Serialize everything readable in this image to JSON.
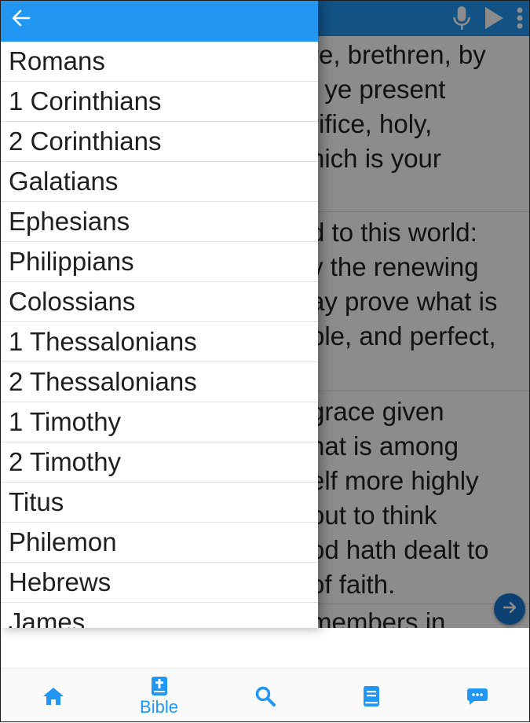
{
  "verses": [
    [
      "re, brethren, by",
      "t ye present",
      "rifice, holy,",
      "hich is your"
    ],
    [
      "d to this world:",
      "y the renewing",
      "ay prove what is",
      "ble, and perfect,"
    ],
    [
      "grace given",
      "hat is among",
      "elf more highly",
      "out to think",
      "od hath dealt to",
      "of faith."
    ],
    [
      "members in"
    ]
  ],
  "drawer": {
    "books": [
      "Romans",
      "1 Corinthians",
      "2 Corinthians",
      "Galatians",
      "Ephesians",
      "Philippians",
      "Colossians",
      "1 Thessalonians",
      "2 Thessalonians",
      "1 Timothy",
      "2 Timothy",
      "Titus",
      "Philemon",
      "Hebrews",
      "James"
    ]
  },
  "bottom_nav": {
    "bible_label": "Bible"
  },
  "icons": {
    "back": "arrow-left-icon",
    "mic": "microphone-icon",
    "play": "play-icon",
    "more": "more-vertical-icon",
    "next": "arrow-right-icon",
    "home": "home-icon",
    "bible": "bible-icon",
    "search": "search-icon",
    "book": "book-icon",
    "chat": "chat-icon"
  },
  "colors": {
    "primary": "#2196F3",
    "fab": "#1976D2"
  }
}
